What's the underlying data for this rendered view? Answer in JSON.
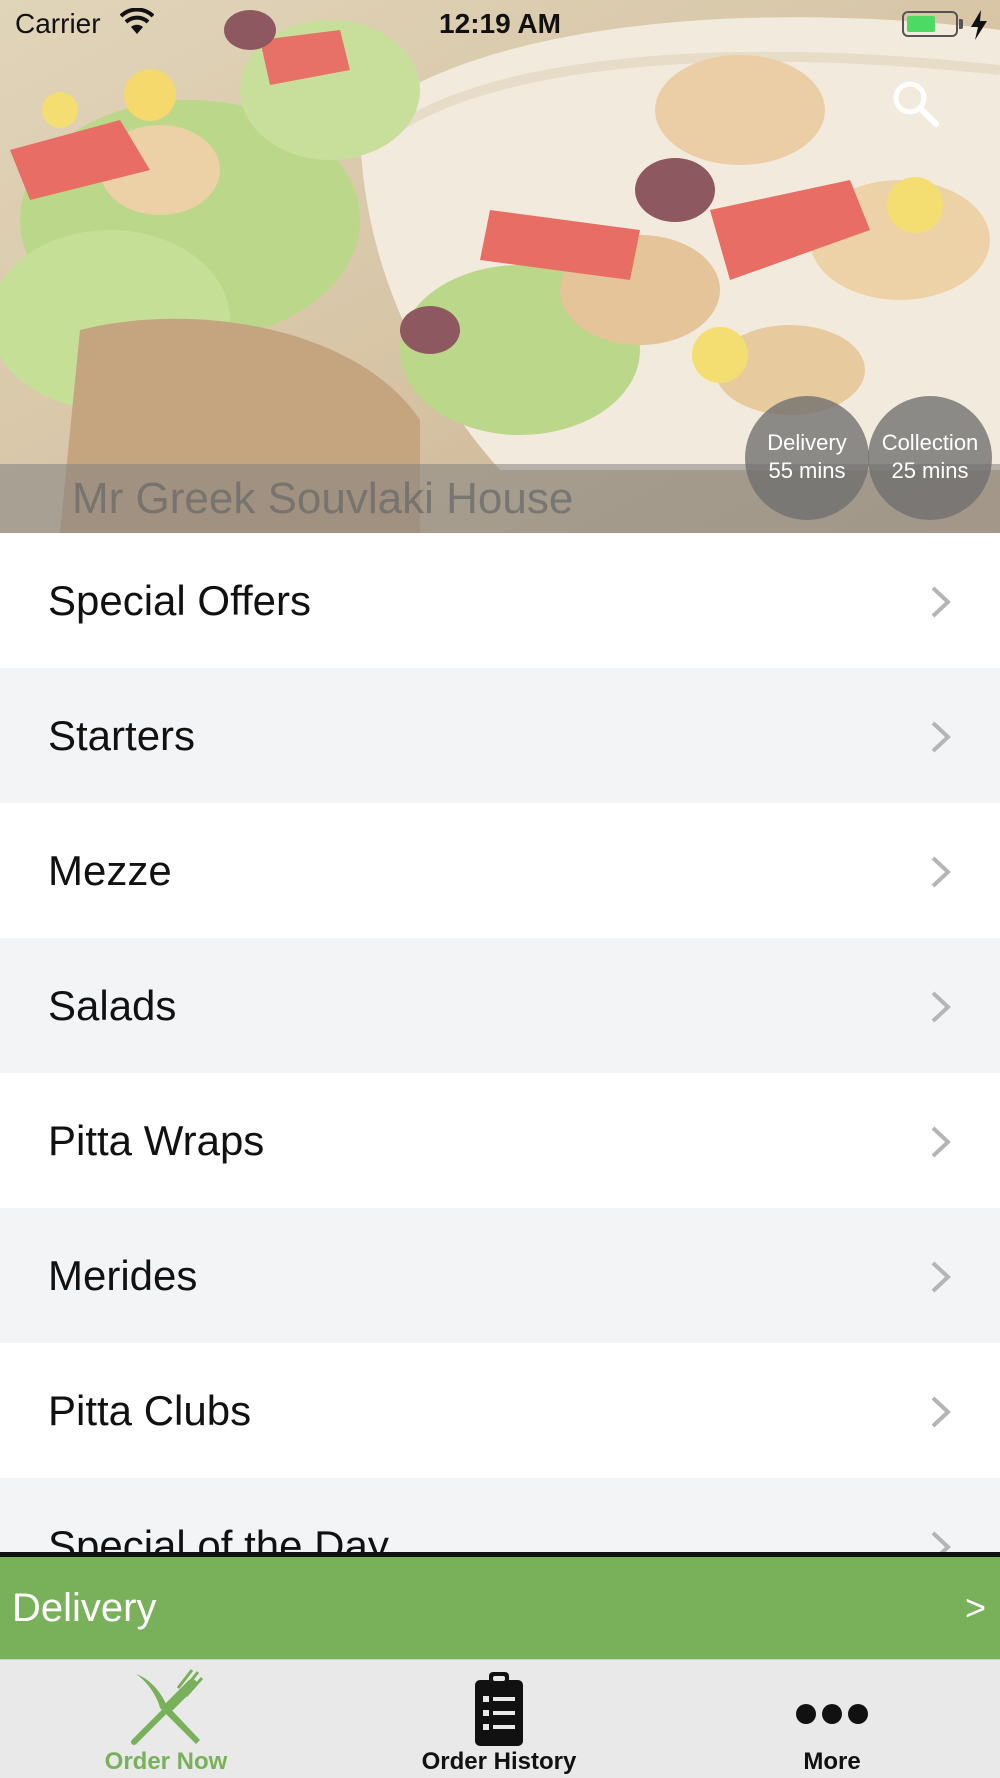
{
  "status_bar": {
    "carrier": "Carrier",
    "time": "12:19 AM"
  },
  "hero": {
    "restaurant_name": "Mr Greek Souvlaki House",
    "search_icon": "search-icon",
    "delivery_badge": {
      "title": "Delivery",
      "time": "55 mins"
    },
    "collection_badge": {
      "title": "Collection",
      "time": "25 mins"
    }
  },
  "menu": {
    "categories": [
      {
        "label": "Special Offers"
      },
      {
        "label": "Starters"
      },
      {
        "label": "Mezze"
      },
      {
        "label": "Salads"
      },
      {
        "label": "Pitta Wraps"
      },
      {
        "label": "Merides"
      },
      {
        "label": "Pitta Clubs"
      },
      {
        "label": "Special of the Day"
      }
    ]
  },
  "order_type_bar": {
    "label": "Delivery",
    "arrow": ">"
  },
  "tab_bar": {
    "tabs": [
      {
        "label": "Order Now",
        "icon": "fork-knife-icon",
        "active": true
      },
      {
        "label": "Order History",
        "icon": "clipboard-list-icon",
        "active": false
      },
      {
        "label": "More",
        "icon": "ellipsis-icon",
        "active": false
      }
    ]
  },
  "colors": {
    "accent": "#79b15b",
    "row_alt": "#f3f4f6",
    "badge": "#6e6e6e"
  }
}
